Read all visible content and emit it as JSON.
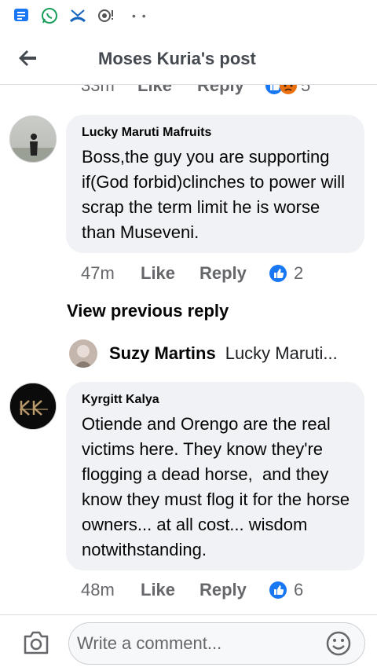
{
  "header": {
    "title": "Moses Kuria's post"
  },
  "top_clipped": {
    "time": "33m",
    "like": "Like",
    "reply": "Reply",
    "reaction_count": "5"
  },
  "comments": [
    {
      "author": "Lucky Maruti Mafruits",
      "text": "Boss,the guy you are supporting if(God forbid)clinches to power will scrap the term limit he is worse than Museveni.",
      "time": "47m",
      "like": "Like",
      "reply": "Reply",
      "reaction_count": "2"
    },
    {
      "author": "Kyrgitt Kalya",
      "text": "Otiende and Orengo are the real victims here. They know they're flogging a dead horse,  and they know they must flog it for the horse owners... at all cost... wisdom notwithstanding.",
      "time": "48m",
      "like": "Like",
      "reply": "Reply",
      "reaction_count": "6"
    }
  ],
  "view_previous": "View previous reply",
  "reply_preview": {
    "name": "Suzy Martins",
    "text": "Lucky Maruti..."
  },
  "composer": {
    "placeholder": "Write a comment..."
  },
  "colors": {
    "accent": "#1877f2",
    "bubble": "#f0f2f5",
    "meta": "#65676b"
  }
}
